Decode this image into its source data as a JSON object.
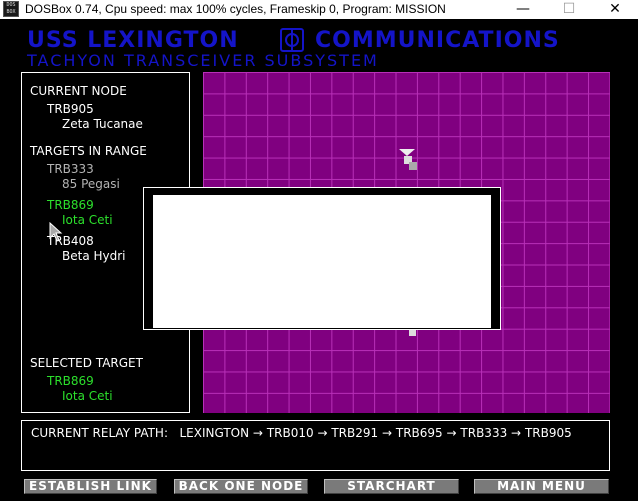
{
  "window": {
    "icon_text": "DOS BOX",
    "title": "DOSBox 0.74, Cpu speed: max 100% cycles, Frameskip  0, Program:  MISSION",
    "minimize_glyph": "—",
    "maximize_glyph": "☐",
    "close_glyph": "✕"
  },
  "header": {
    "title_left": "USS LEXINGTON",
    "title_right": "COMMUNICATIONS",
    "subtitle": "TACHYON TRANSCEIVER SUBSYSTEM",
    "emblem_icon": "lexington-emblem-icon"
  },
  "left_panel": {
    "current_node_label": "CURRENT NODE",
    "current_node": {
      "id": "TRB905",
      "name": "Zeta Tucanae"
    },
    "targets_label": "TARGETS IN RANGE",
    "targets": [
      {
        "id": "TRB333",
        "name": "85 Pegasi",
        "state": "dimmed"
      },
      {
        "id": "TRB869",
        "name": "Iota Ceti",
        "state": "selected"
      },
      {
        "id": "TRB408",
        "name": "Beta Hydri",
        "state": "normal"
      }
    ],
    "selected_label": "SELECTED TARGET",
    "selected_target": {
      "id": "TRB869",
      "name": "Iota Ceti"
    }
  },
  "relay": {
    "label": "CURRENT RELAY PATH:",
    "path": [
      "LEXINGTON",
      "TRB010",
      "TRB291",
      "TRB695",
      "TRB333",
      "TRB905"
    ],
    "arrow": "→"
  },
  "buttons": {
    "establish": "ESTABLISH LINK",
    "back": "BACK ONE NODE",
    "starchart": "STARCHART",
    "main_menu": "MAIN MENU"
  },
  "colors": {
    "header_blue": "#1414c8",
    "grid_purple": "#800080",
    "grid_line": "#b830b8",
    "selected_green": "#2ce02c",
    "dimmed_gray": "#b4b4b4"
  }
}
